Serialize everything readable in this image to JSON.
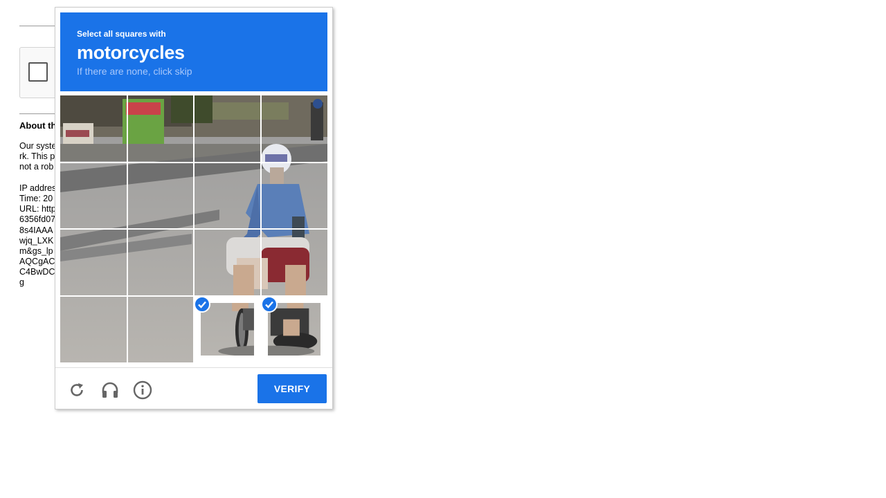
{
  "page": {
    "about_heading": "About th",
    "body_lines": [
      "Our syste",
      "rk. This p",
      "not a rob",
      "",
      "IP addres",
      "Time: 20",
      "URL: http",
      "6356fd07",
      "8s4IAAA",
      "wjq_LXK",
      "m&gs_lp",
      "AQCgAC",
      "C4BwDC",
      "g"
    ]
  },
  "challenge": {
    "instruction_small": "Select all squares with",
    "target_object": "motorcycles",
    "skip_hint": "If there are none, click skip",
    "verify_label": "VERIFY",
    "accent_color": "#1a73e8",
    "tiles": [
      {
        "row": 1,
        "col": 1,
        "selected": false
      },
      {
        "row": 1,
        "col": 2,
        "selected": false
      },
      {
        "row": 1,
        "col": 3,
        "selected": false
      },
      {
        "row": 1,
        "col": 4,
        "selected": false
      },
      {
        "row": 2,
        "col": 1,
        "selected": false
      },
      {
        "row": 2,
        "col": 2,
        "selected": false
      },
      {
        "row": 2,
        "col": 3,
        "selected": false
      },
      {
        "row": 2,
        "col": 4,
        "selected": false
      },
      {
        "row": 3,
        "col": 1,
        "selected": false
      },
      {
        "row": 3,
        "col": 2,
        "selected": false
      },
      {
        "row": 3,
        "col": 3,
        "selected": false
      },
      {
        "row": 3,
        "col": 4,
        "selected": false
      },
      {
        "row": 4,
        "col": 1,
        "selected": false
      },
      {
        "row": 4,
        "col": 2,
        "selected": false
      },
      {
        "row": 4,
        "col": 3,
        "selected": true
      },
      {
        "row": 4,
        "col": 4,
        "selected": true
      }
    ],
    "controls": [
      {
        "name": "reload-icon"
      },
      {
        "name": "headphones-icon"
      },
      {
        "name": "info-icon"
      }
    ]
  }
}
